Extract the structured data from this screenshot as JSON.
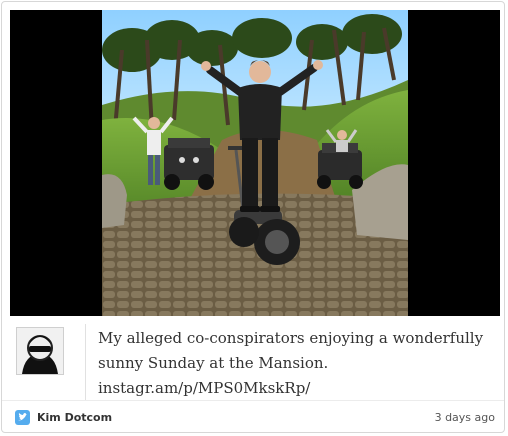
{
  "tweet": {
    "text_line1": "My alleged co-conspirators enjoying a wonderfully",
    "text_line2": "sunny Sunday at the Mansion.",
    "link": "instagr.am/p/MPS0MkskRp/"
  },
  "author": {
    "name": "Kim Dotcom"
  },
  "meta": {
    "timestamp": "3 days ago"
  },
  "icons": {
    "service": "twitter-bird-icon"
  },
  "colors": {
    "twitter_blue": "#55acee",
    "border": "#d7d7d7",
    "text": "#333333"
  }
}
